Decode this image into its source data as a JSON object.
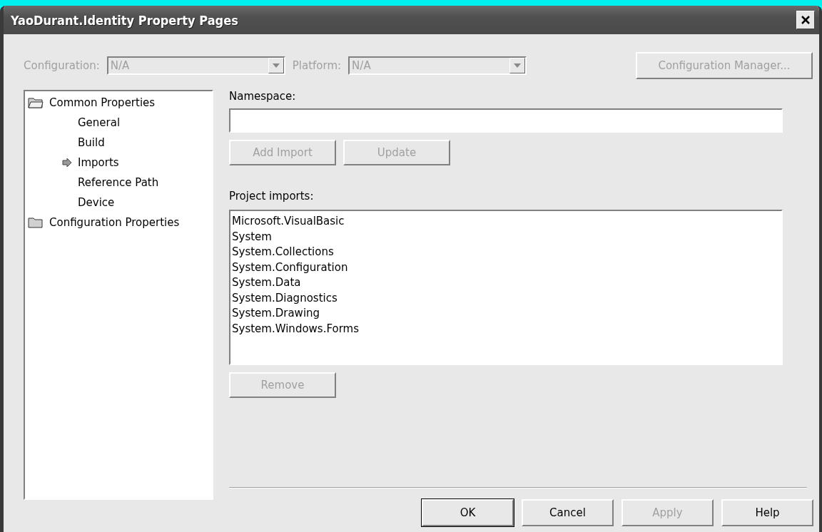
{
  "window": {
    "title": "YaoDurant.Identity Property Pages"
  },
  "config_bar": {
    "configuration": {
      "label": "Configuration:",
      "value": "N/A",
      "disabled": true
    },
    "platform": {
      "label": "Platform:",
      "value": "N/A",
      "disabled": true
    },
    "manager_button": {
      "label": "Configuration Manager...",
      "disabled": true
    }
  },
  "tree": [
    {
      "label": "Common Properties",
      "expanded": true,
      "children": [
        {
          "label": "General",
          "selected": false
        },
        {
          "label": "Build",
          "selected": false
        },
        {
          "label": "Imports",
          "selected": true
        },
        {
          "label": "Reference Path",
          "selected": false
        },
        {
          "label": "Device",
          "selected": false
        }
      ]
    },
    {
      "label": "Configuration Properties",
      "expanded": false
    }
  ],
  "namespace": {
    "label": "Namespace:"
  },
  "namespace_buttons": [
    {
      "label": "Add Import",
      "disabled": true
    },
    {
      "label": "Update",
      "disabled": true
    }
  ],
  "imports": {
    "label": "Project imports:",
    "items": [
      "Microsoft.VisualBasic",
      "System",
      "System.Collections",
      "System.Configuration",
      "System.Data",
      "System.Diagnostics",
      "System.Drawing",
      "System.Windows.Forms"
    ]
  },
  "remove_button": {
    "label": "Remove",
    "disabled": true
  },
  "footer_buttons": [
    {
      "label": "OK",
      "disabled": false,
      "default": true
    },
    {
      "label": "Cancel",
      "disabled": false,
      "default": false
    },
    {
      "label": "Apply",
      "disabled": true,
      "default": false
    },
    {
      "label": "Help",
      "disabled": false,
      "default": false
    }
  ]
}
